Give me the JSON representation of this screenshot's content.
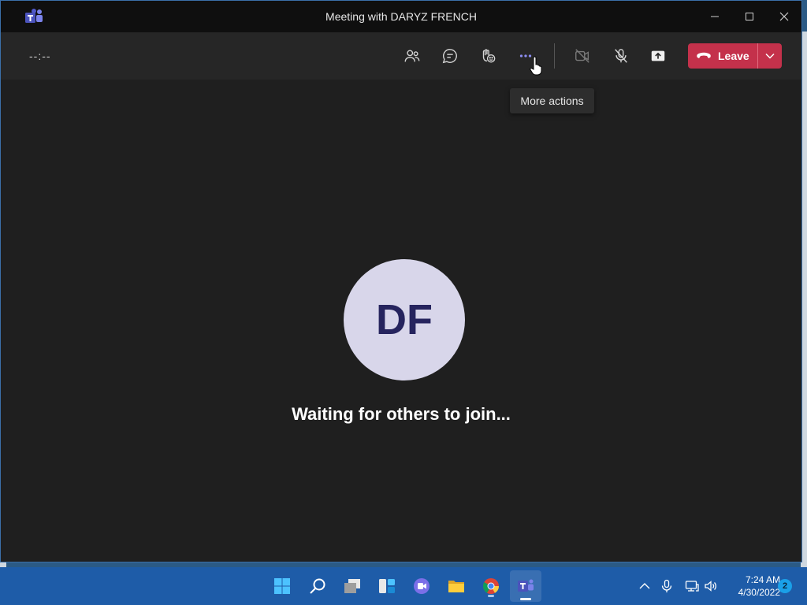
{
  "window": {
    "title": "Meeting with DARYZ FRENCH"
  },
  "toolbar": {
    "timer": "--:--",
    "buttons": [
      {
        "name": "people-icon"
      },
      {
        "name": "chat-icon"
      },
      {
        "name": "react-icon"
      },
      {
        "name": "more-actions-icon"
      },
      {
        "name": "camera-off-icon"
      },
      {
        "name": "mic-off-icon"
      },
      {
        "name": "share-icon"
      }
    ],
    "leave_label": "Leave",
    "leave_color": "#c4314b",
    "more_color": "#8b8cf0"
  },
  "tooltip": {
    "text": "More actions"
  },
  "main": {
    "avatar_initials": "DF",
    "avatar_bg": "#d8d6ea",
    "avatar_fg": "#26245e",
    "status": "Waiting for others to join..."
  },
  "taskbar": {
    "apps": [
      {
        "name": "start-icon"
      },
      {
        "name": "search-icon"
      },
      {
        "name": "task-view-icon"
      },
      {
        "name": "widgets-icon"
      },
      {
        "name": "teams-chat-icon"
      },
      {
        "name": "file-explorer-icon"
      },
      {
        "name": "chrome-icon"
      },
      {
        "name": "teams-icon"
      }
    ],
    "tray": [
      {
        "name": "chevron-up-icon"
      },
      {
        "name": "microphone-icon"
      },
      {
        "name": "network-icon"
      },
      {
        "name": "volume-icon"
      }
    ],
    "time": "7:24 AM",
    "date": "4/30/2022",
    "notifications": "2"
  }
}
